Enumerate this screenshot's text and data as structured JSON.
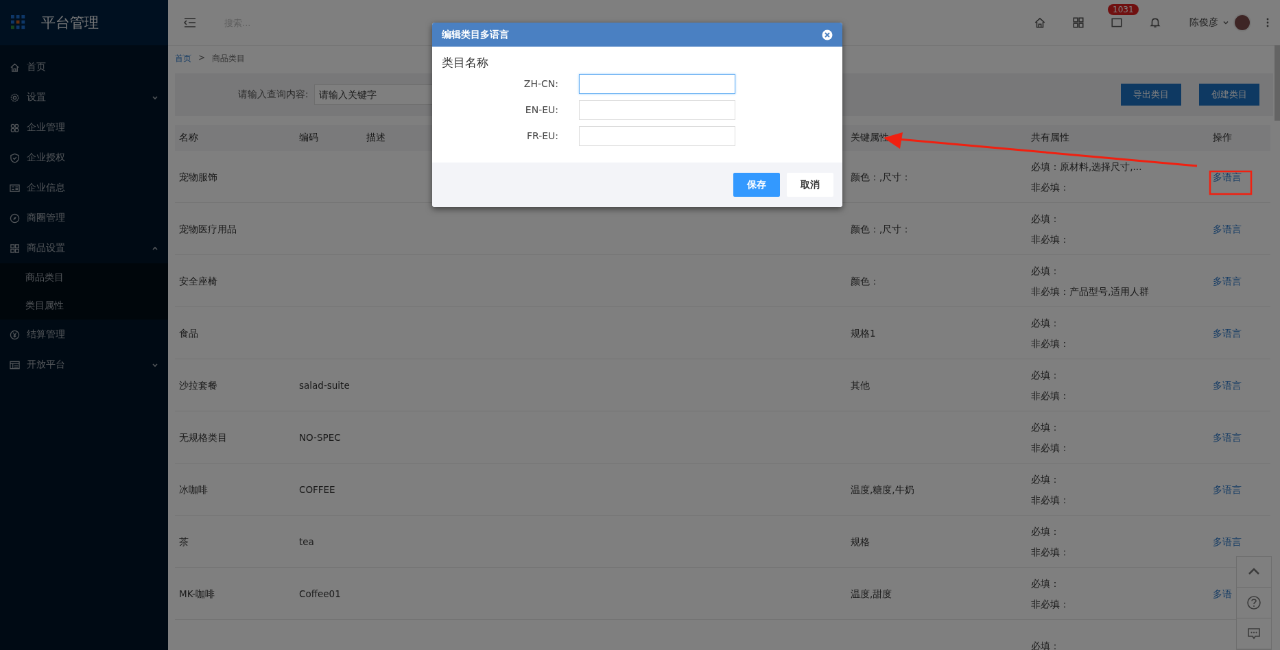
{
  "sidebar": {
    "title": "平台管理",
    "items": [
      {
        "label": "首页",
        "kind": "link"
      },
      {
        "label": "设置",
        "kind": "group",
        "expanded": false
      },
      {
        "label": "企业管理",
        "kind": "link"
      },
      {
        "label": "企业授权",
        "kind": "link"
      },
      {
        "label": "企业信息",
        "kind": "link"
      },
      {
        "label": "商圈管理",
        "kind": "link"
      },
      {
        "label": "商品设置",
        "kind": "group",
        "expanded": true,
        "children": [
          {
            "label": "商品类目"
          },
          {
            "label": "类目属性"
          }
        ]
      },
      {
        "label": "结算管理",
        "kind": "link"
      },
      {
        "label": "开放平台",
        "kind": "group",
        "expanded": false
      }
    ]
  },
  "header": {
    "search": {
      "placeholder": "搜索..."
    },
    "icons": [
      {
        "kind": "home"
      },
      {
        "kind": "grid"
      },
      {
        "kind": "box",
        "badge": "1031"
      },
      {
        "kind": "bell"
      }
    ],
    "user": "陈俊彦"
  },
  "breadcrumb": {
    "items": [
      "首页",
      "商品类目"
    ],
    "separator": ">"
  },
  "filter": {
    "label": "请输入查询内容:",
    "placeholder": "请输入关键字",
    "buttons": [
      "导出类目",
      "创建类目"
    ]
  },
  "table": {
    "columns": [
      "名称",
      "编码",
      "描述",
      "关键属性",
      "共有属性",
      "操作"
    ],
    "rows": [
      {
        "name": "宠物服饰",
        "code": "",
        "key": "颜色：,尺寸：",
        "required": "必填：原材料,选择尺寸,...",
        "optional": "非必填：",
        "action": "多语言"
      },
      {
        "name": "宠物医疗用品",
        "code": "",
        "key": "颜色：,尺寸：",
        "required": "必填：",
        "optional": "非必填：",
        "action": "多语言"
      },
      {
        "name": "安全座椅",
        "code": "",
        "key": "颜色：",
        "required": "必填：",
        "optional": "非必填：产品型号,适用人群",
        "action": "多语言"
      },
      {
        "name": "食品",
        "code": "",
        "key": "规格1",
        "required": "必填：",
        "optional": "非必填：",
        "action": "多语言"
      },
      {
        "name": "沙拉套餐",
        "code": "salad-suite",
        "key": "其他",
        "required": "必填：",
        "optional": "非必填：",
        "action": "多语言"
      },
      {
        "name": "无规格类目",
        "code": "NO-SPEC",
        "key": "",
        "required": "必填：",
        "optional": "非必填：",
        "action": "多语言"
      },
      {
        "name": "冰咖啡",
        "code": "COFFEE",
        "key": "温度,糖度,牛奶",
        "required": "必填：",
        "optional": "非必填：",
        "action": "多语言"
      },
      {
        "name": "茶",
        "code": "tea",
        "key": "规格",
        "required": "必填：",
        "optional": "非必填：",
        "action": "多语言"
      },
      {
        "name": "MK-咖啡",
        "code": "Coffee01",
        "key": "温度,甜度",
        "required": "必填：",
        "optional": "非必填：",
        "action": "多语"
      },
      {
        "name": "",
        "code": "",
        "key": "",
        "required": "必填：",
        "optional": "",
        "action": ""
      }
    ]
  },
  "dialog": {
    "title": "编辑类目多语言",
    "section": "类目名称",
    "fields": [
      {
        "label": "ZH-CN:",
        "focused": true
      },
      {
        "label": "EN-EU:",
        "focused": false
      },
      {
        "label": "FR-EU:",
        "focused": false
      }
    ],
    "buttons": [
      {
        "label": "保存",
        "kind": "primary"
      },
      {
        "label": "取消",
        "kind": "default"
      }
    ]
  }
}
